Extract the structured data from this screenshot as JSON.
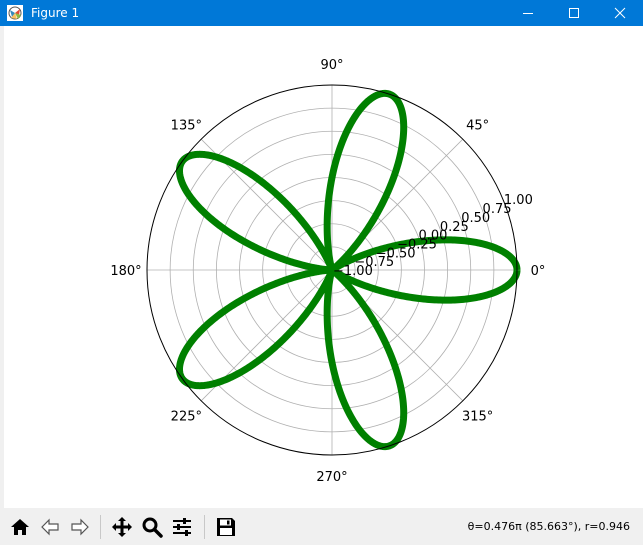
{
  "window": {
    "title": "Figure 1"
  },
  "toolbar": {
    "buttons": [
      {
        "name": "home-button",
        "icon": "home-icon"
      },
      {
        "name": "back-button",
        "icon": "back-arrow-icon"
      },
      {
        "name": "forward-button",
        "icon": "forward-arrow-icon"
      },
      {
        "name": "pan-button",
        "icon": "move-arrows-icon"
      },
      {
        "name": "zoom-button",
        "icon": "magnifier-icon"
      },
      {
        "name": "configure-subplots-button",
        "icon": "sliders-icon"
      },
      {
        "name": "save-button",
        "icon": "floppy-disk-icon"
      }
    ],
    "status": "θ=0.476π (85.663°), r=0.946"
  },
  "chart_data": {
    "type": "line",
    "projection": "polar",
    "function": "r = cos(5θ)",
    "theta_tick_labels": [
      "0°",
      "45°",
      "90°",
      "135°",
      "180°",
      "225°",
      "270°",
      "315°"
    ],
    "r_tick_labels": [
      "−1.00",
      "−0.75",
      "−0.50",
      "−0.25",
      "0.00",
      "0.25",
      "0.50",
      "0.75",
      "1.00"
    ],
    "r_ticks": [
      -1.0,
      -0.75,
      -0.5,
      -0.25,
      0.0,
      0.25,
      0.5,
      0.75,
      1.0
    ],
    "rlim": [
      -1.0,
      1.0
    ],
    "r_label_angle_deg": 22.5,
    "grid": true,
    "series": [
      {
        "petals": 5,
        "color": "#008000"
      }
    ]
  }
}
